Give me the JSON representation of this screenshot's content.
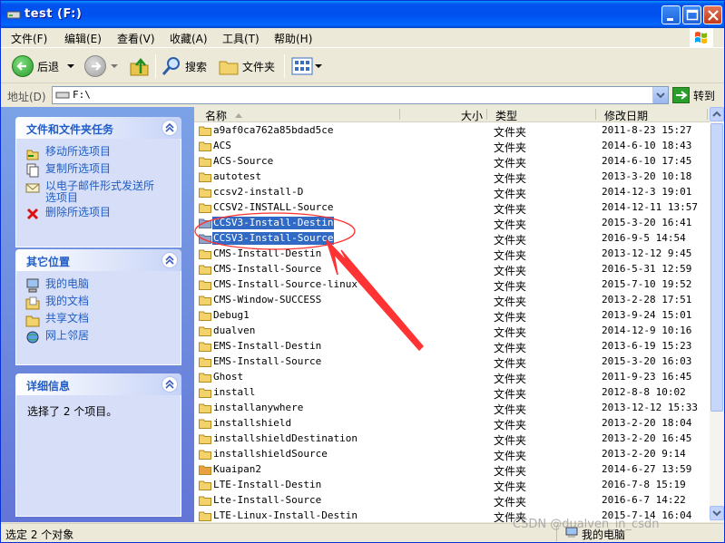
{
  "window": {
    "title": "test  (F:)"
  },
  "menu": [
    "文件(F)",
    "编辑(E)",
    "查看(V)",
    "收藏(A)",
    "工具(T)",
    "帮助(H)"
  ],
  "toolbar": {
    "back_label": "后退",
    "search_label": "搜索",
    "folders_label": "文件夹"
  },
  "address": {
    "label": "地址(D)",
    "value": "F:\\",
    "go_label": "转到"
  },
  "tasks": {
    "title": "文件和文件夹任务",
    "items": [
      "移动所选项目",
      "复制所选项目",
      "以电子邮件形式发送所选项目",
      "删除所选项目"
    ]
  },
  "places": {
    "title": "其它位置",
    "items": [
      "我的电脑",
      "我的文档",
      "共享文档",
      "网上邻居"
    ]
  },
  "details": {
    "title": "详细信息",
    "text": "选择了 2 个项目。"
  },
  "columns": {
    "name": "名称",
    "size": "大小",
    "type": "类型",
    "modified": "修改日期"
  },
  "files": [
    {
      "name": "a9af0ca762a85bdad5ce",
      "type": "文件夹",
      "date": "2011-8-23 15:27",
      "selected": false
    },
    {
      "name": "ACS",
      "type": "文件夹",
      "date": "2014-6-10 18:43",
      "selected": false
    },
    {
      "name": "ACS-Source",
      "type": "文件夹",
      "date": "2014-6-10 17:45",
      "selected": false
    },
    {
      "name": "autotest",
      "type": "文件夹",
      "date": "2013-3-20 10:18",
      "selected": false
    },
    {
      "name": "ccsv2-install-D",
      "type": "文件夹",
      "date": "2014-12-3 19:01",
      "selected": false
    },
    {
      "name": "CCSV2-INSTALL-Source",
      "type": "文件夹",
      "date": "2014-12-11 13:57",
      "selected": false
    },
    {
      "name": "CCSV3-Install-Destin",
      "type": "文件夹",
      "date": "2015-3-20 16:41",
      "selected": true
    },
    {
      "name": "CCSV3-Install-Source",
      "type": "文件夹",
      "date": "2016-9-5 14:54",
      "selected": true
    },
    {
      "name": "CMS-Install-Destin",
      "type": "文件夹",
      "date": "2013-12-12 9:45",
      "selected": false
    },
    {
      "name": "CMS-Install-Source",
      "type": "文件夹",
      "date": "2016-5-31 12:59",
      "selected": false
    },
    {
      "name": "CMS-Install-Source-linux",
      "type": "文件夹",
      "date": "2015-7-10 19:52",
      "selected": false
    },
    {
      "name": "CMS-Window-SUCCESS",
      "type": "文件夹",
      "date": "2013-2-28 17:51",
      "selected": false
    },
    {
      "name": "Debug1",
      "type": "文件夹",
      "date": "2013-9-24 15:01",
      "selected": false
    },
    {
      "name": "dualven",
      "type": "文件夹",
      "date": "2014-12-9 10:16",
      "selected": false
    },
    {
      "name": "EMS-Install-Destin",
      "type": "文件夹",
      "date": "2013-6-19 15:23",
      "selected": false
    },
    {
      "name": "EMS-Install-Source",
      "type": "文件夹",
      "date": "2015-3-20 16:03",
      "selected": false
    },
    {
      "name": "Ghost",
      "type": "文件夹",
      "date": "2011-9-23 16:45",
      "selected": false
    },
    {
      "name": "install",
      "type": "文件夹",
      "date": "2012-8-8 10:02",
      "selected": false
    },
    {
      "name": "installanywhere",
      "type": "文件夹",
      "date": "2013-12-12 15:33",
      "selected": false
    },
    {
      "name": "installshield",
      "type": "文件夹",
      "date": "2013-2-20 18:04",
      "selected": false
    },
    {
      "name": "installshieldDestination",
      "type": "文件夹",
      "date": "2013-2-20 16:45",
      "selected": false
    },
    {
      "name": "installshieldSource",
      "type": "文件夹",
      "date": "2013-2-20 9:14",
      "selected": false
    },
    {
      "name": "Kuaipan2",
      "type": "文件夹",
      "date": "2014-6-27 13:59",
      "selected": false
    },
    {
      "name": "LTE-Install-Destin",
      "type": "文件夹",
      "date": "2016-7-8 15:19",
      "selected": false
    },
    {
      "name": "Lte-Install-Source",
      "type": "文件夹",
      "date": "2016-6-7 14:22",
      "selected": false
    },
    {
      "name": "LTE-Linux-Install-Destin",
      "type": "文件夹",
      "date": "2015-7-14 16:04",
      "selected": false
    }
  ],
  "status": {
    "left": "选定 2 个对象",
    "right": "我的电脑"
  },
  "watermark": "CSDN @dualven_in_csdn",
  "colors": {
    "title_bar": "#0053ee",
    "task_pane": "#6375d6",
    "selection": "#316ac5",
    "annotation": "#ff3333"
  }
}
